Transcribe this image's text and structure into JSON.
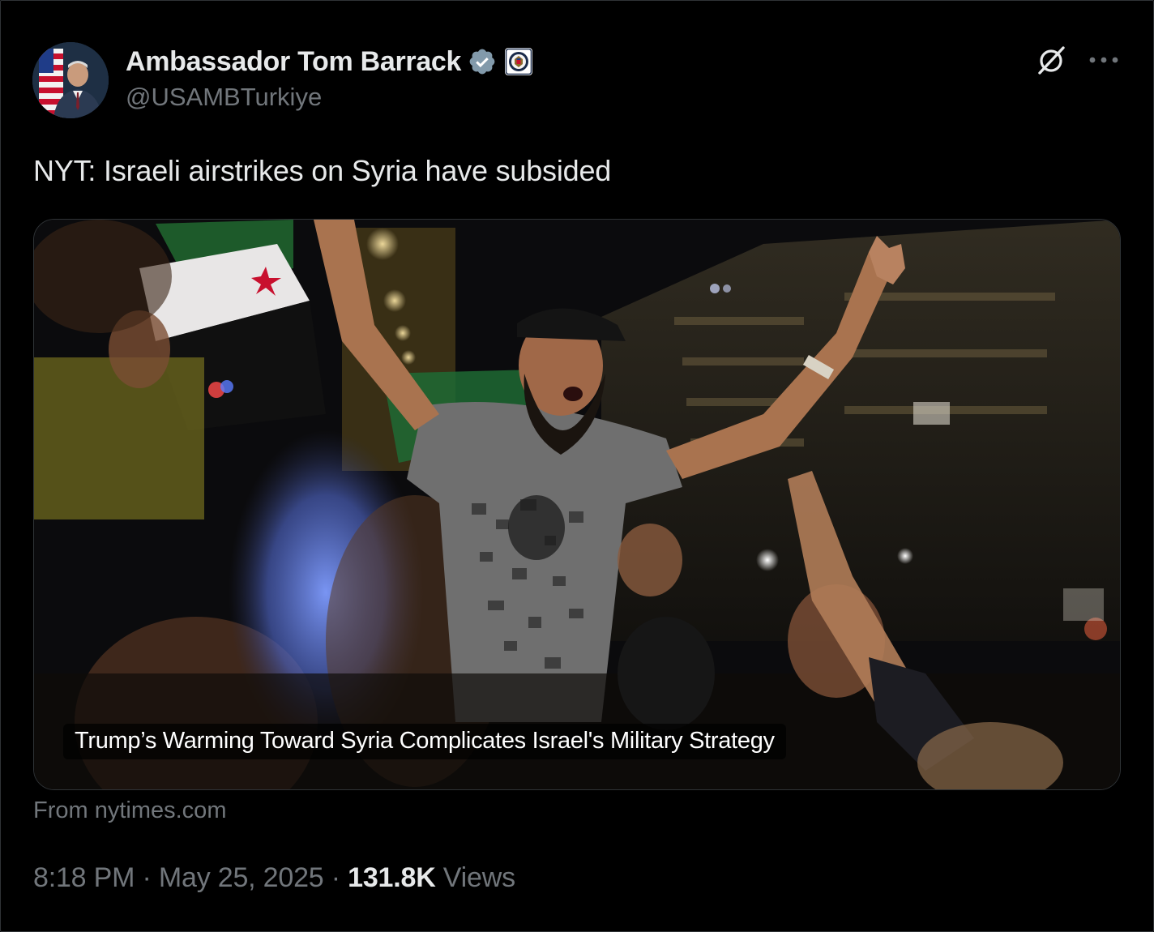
{
  "author": {
    "display_name": "Ambassador Tom Barrack",
    "handle": "@USAMBTurkiye",
    "verified_badge_icon": "verified-badge-icon",
    "affiliation_icon": "state-department-seal-icon"
  },
  "tweet": {
    "text": "NYT: Israeli airstrikes on Syria have subsided"
  },
  "link_card": {
    "headline": "Trump’s Warming Toward Syria Complicates Israel's Military Strategy",
    "source": "From nytimes.com"
  },
  "meta": {
    "time": "8:18 PM",
    "separator": " · ",
    "date": "May 25, 2025",
    "views_count": "131.8K",
    "views_label": " Views"
  },
  "icons": {
    "grok": "grok-icon",
    "more": "more-icon"
  },
  "colors": {
    "background": "#000000",
    "text_primary": "#e7e9ea",
    "text_secondary": "#71767b",
    "verified_badge": "#829aab",
    "border": "#2f3336"
  }
}
